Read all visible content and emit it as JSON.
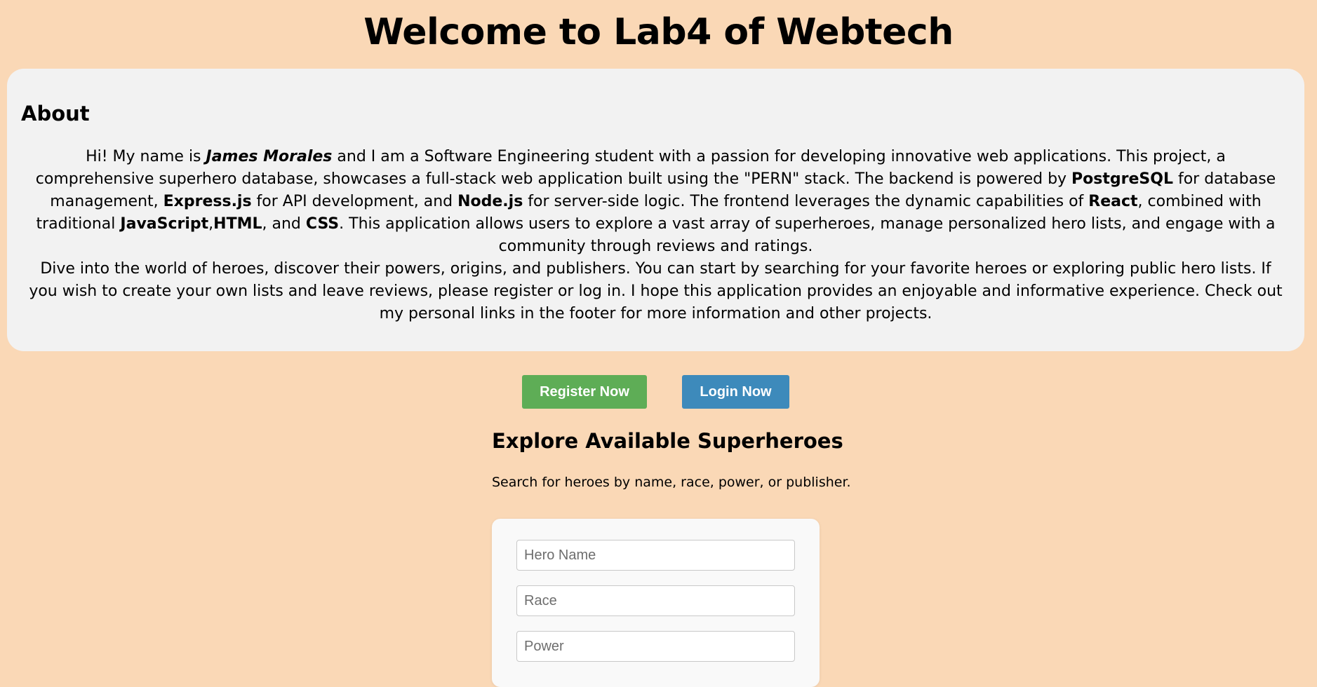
{
  "page": {
    "title": "Welcome to Lab4 of Webtech"
  },
  "about": {
    "heading": "About",
    "p1": {
      "t1": "Hi! My name is ",
      "name": "James Morales",
      "t2": " and I am a Software Engineering student with a passion for developing innovative web applications. This project, a comprehensive superhero database, showcases a full-stack web application built using the \"PERN\" stack. The backend is powered by ",
      "postgres": "PostgreSQL",
      "t3": " for database management, ",
      "express": "Express.js",
      "t4": " for API development, and ",
      "node": "Node.js",
      "t5": " for server-side logic. The frontend leverages the dynamic capabilities of ",
      "react": "React",
      "t6": ", combined with traditional ",
      "javascript": "JavaScript",
      "t7": ",",
      "html": "HTML",
      "t8": ", and ",
      "css": "CSS",
      "t9": ". This application allows users to explore a vast array of superheroes, manage personalized hero lists, and engage with a community through reviews and ratings."
    },
    "p2": "Dive into the world of heroes, discover their powers, origins, and publishers. You can start by searching for your favorite heroes or exploring public hero lists. If you wish to create your own lists and leave reviews, please register or log in. I hope this application provides an enjoyable and informative experience. Check out my personal links in the footer for more information and other projects."
  },
  "actions": {
    "register_label": "Register Now",
    "login_label": "Login Now"
  },
  "explore": {
    "heading": "Explore Available Superheroes",
    "description": "Search for heroes by name, race, power, or publisher."
  },
  "search": {
    "name_placeholder": "Hero Name",
    "race_placeholder": "Race",
    "power_placeholder": "Power"
  },
  "colors": {
    "page_background": "#fad8b6",
    "card_background": "#f2f2f2",
    "register_button": "#5ead56",
    "login_button": "#3d8abb"
  }
}
